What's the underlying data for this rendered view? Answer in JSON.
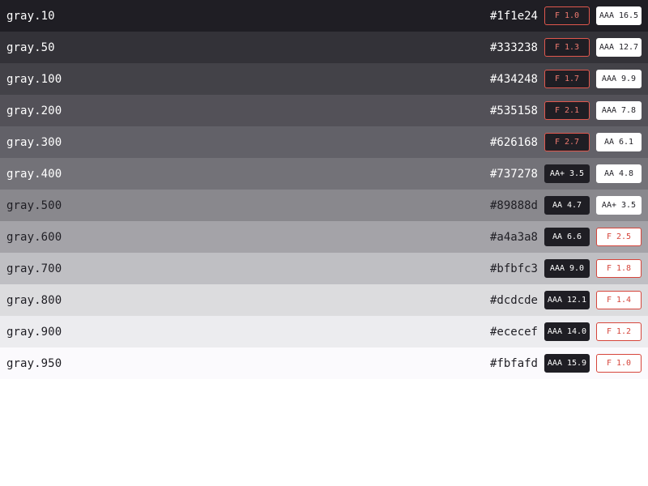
{
  "swatches": [
    {
      "name": "gray.10",
      "hex": "#1f1e24",
      "bg": "#1f1e24",
      "fg": "#ffffff",
      "on_dark": "F 1.0",
      "on_dark_pass": false,
      "on_light": "AAA 16.5",
      "on_light_pass": true
    },
    {
      "name": "gray.50",
      "hex": "#333238",
      "bg": "#333238",
      "fg": "#ffffff",
      "on_dark": "F 1.3",
      "on_dark_pass": false,
      "on_light": "AAA 12.7",
      "on_light_pass": true
    },
    {
      "name": "gray.100",
      "hex": "#434248",
      "bg": "#434248",
      "fg": "#ffffff",
      "on_dark": "F 1.7",
      "on_dark_pass": false,
      "on_light": "AAA 9.9",
      "on_light_pass": true
    },
    {
      "name": "gray.200",
      "hex": "#535158",
      "bg": "#535158",
      "fg": "#ffffff",
      "on_dark": "F 2.1",
      "on_dark_pass": false,
      "on_light": "AAA 7.8",
      "on_light_pass": true
    },
    {
      "name": "gray.300",
      "hex": "#626168",
      "bg": "#626168",
      "fg": "#ffffff",
      "on_dark": "F 2.7",
      "on_dark_pass": false,
      "on_light": "AA 6.1",
      "on_light_pass": true
    },
    {
      "name": "gray.400",
      "hex": "#737278",
      "bg": "#737278",
      "fg": "#ffffff",
      "on_dark": "AA+ 3.5",
      "on_dark_pass": true,
      "on_light": "AA 4.8",
      "on_light_pass": true
    },
    {
      "name": "gray.500",
      "hex": "#89888d",
      "bg": "#89888d",
      "fg": "#1f1e24",
      "on_dark": "AA 4.7",
      "on_dark_pass": true,
      "on_light": "AA+ 3.5",
      "on_light_pass": true
    },
    {
      "name": "gray.600",
      "hex": "#a4a3a8",
      "bg": "#a4a3a8",
      "fg": "#1f1e24",
      "on_dark": "AA 6.6",
      "on_dark_pass": true,
      "on_light": "F 2.5",
      "on_light_pass": false
    },
    {
      "name": "gray.700",
      "hex": "#bfbfc3",
      "bg": "#bfbfc3",
      "fg": "#1f1e24",
      "on_dark": "AAA 9.0",
      "on_dark_pass": true,
      "on_light": "F 1.8",
      "on_light_pass": false
    },
    {
      "name": "gray.800",
      "hex": "#dcdcde",
      "bg": "#dcdcde",
      "fg": "#1f1e24",
      "on_dark": "AAA 12.1",
      "on_dark_pass": true,
      "on_light": "F 1.4",
      "on_light_pass": false
    },
    {
      "name": "gray.900",
      "hex": "#ececef",
      "bg": "#ececef",
      "fg": "#1f1e24",
      "on_dark": "AAA 14.0",
      "on_dark_pass": true,
      "on_light": "F 1.2",
      "on_light_pass": false
    },
    {
      "name": "gray.950",
      "hex": "#fbfafd",
      "bg": "#fbfafd",
      "fg": "#1f1e24",
      "on_dark": "AAA 15.9",
      "on_dark_pass": true,
      "on_light": "F 1.0",
      "on_light_pass": false
    }
  ]
}
